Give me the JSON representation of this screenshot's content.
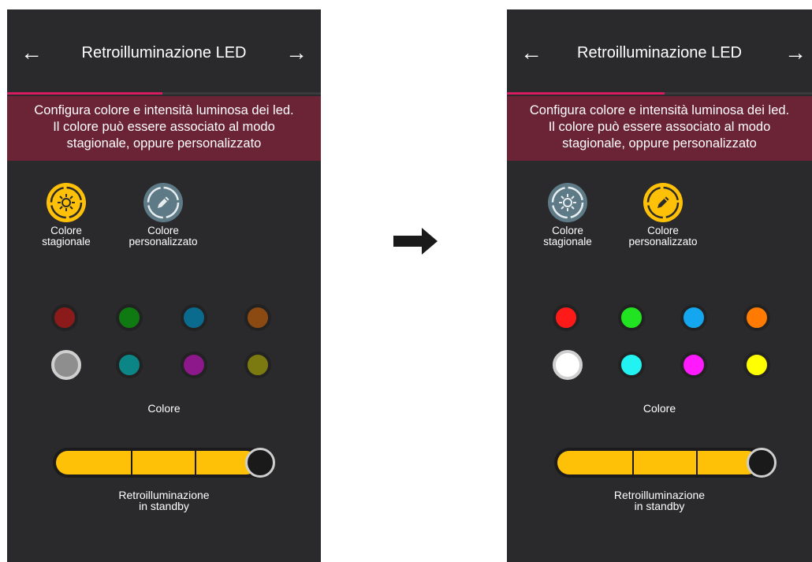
{
  "screens": [
    {
      "title": "Retroilluminazione LED",
      "progress": 0.5,
      "description": [
        "Configura colore e intensità luminosa dei led.",
        "Il colore può essere associato al modo",
        "stagionale, oppure personalizzato"
      ],
      "modes": [
        {
          "label_line1": "Colore",
          "label_line2": "stagionale",
          "icon": "sun-icon",
          "active": true
        },
        {
          "label_line1": "Colore",
          "label_line2": "personalizzato",
          "icon": "pencil-icon",
          "active": false
        }
      ],
      "swatches": [
        "#8b1a1a",
        "#0f7a12",
        "#0a6b8e",
        "#8a4a12",
        "#8e8e8e",
        "#0b8585",
        "#8c188c",
        "#7a7a10"
      ],
      "selected_swatch": 4,
      "color_label": "Colore",
      "standby_label_line1": "Retroilluminazione",
      "standby_label_line2": "in standby",
      "standby_level": 3
    },
    {
      "title": "Retroilluminazione LED",
      "progress": 0.5,
      "description": [
        "Configura colore e intensità luminosa dei led.",
        "Il colore può essere associato al modo",
        "stagionale, oppure personalizzato"
      ],
      "modes": [
        {
          "label_line1": "Colore",
          "label_line2": "stagionale",
          "icon": "sun-icon",
          "active": false
        },
        {
          "label_line1": "Colore",
          "label_line2": "personalizzato",
          "icon": "pencil-icon",
          "active": true
        }
      ],
      "swatches": [
        "#ff1a1a",
        "#22e322",
        "#14a7f0",
        "#ff7a00",
        "#ffffff",
        "#22f2f2",
        "#ff1aff",
        "#ffff00"
      ],
      "selected_swatch": 4,
      "color_label": "Colore",
      "standby_label_line1": "Retroilluminazione",
      "standby_label_line2": "in standby",
      "standby_level": 3
    }
  ],
  "colors": {
    "accent": "#ffc107",
    "inactive_icon": "#5d7a86",
    "banner": "#6b2336",
    "progress": "#d81b60"
  }
}
